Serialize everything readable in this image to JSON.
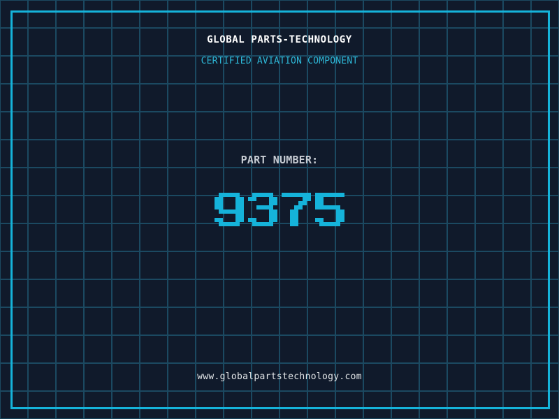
{
  "header": {
    "title": "GLOBAL PARTS-TECHNOLOGY",
    "subtitle": "CERTIFIED AVIATION COMPONENT"
  },
  "part": {
    "label": "PART NUMBER:",
    "number": "9375"
  },
  "footer": {
    "url": "www.globalpartstechnology.com"
  },
  "colors": {
    "background": "#101a2b",
    "grid-line": "#1b4961",
    "accent": "#15b3da",
    "title": "#ffffff",
    "subtitle": "#2eb9d9",
    "label": "#c7ccd3",
    "url": "#e4e7e9"
  }
}
